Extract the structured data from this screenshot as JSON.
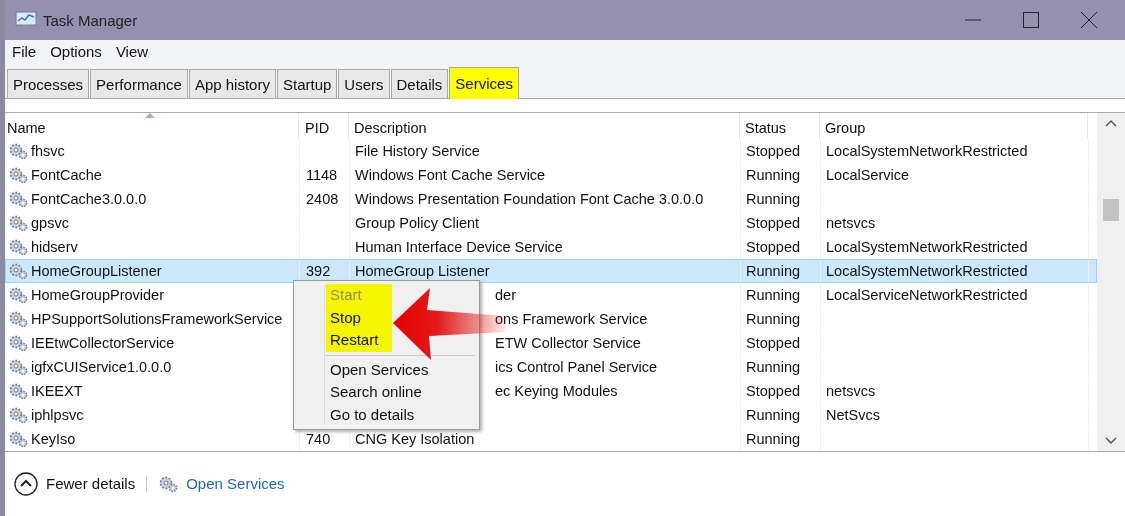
{
  "window": {
    "title": "Task Manager"
  },
  "menu": [
    "File",
    "Options",
    "View"
  ],
  "tabs": [
    {
      "label": "Processes",
      "selected": false,
      "highlighted": false
    },
    {
      "label": "Performance",
      "selected": false,
      "highlighted": false
    },
    {
      "label": "App history",
      "selected": false,
      "highlighted": false
    },
    {
      "label": "Startup",
      "selected": false,
      "highlighted": false
    },
    {
      "label": "Users",
      "selected": false,
      "highlighted": false
    },
    {
      "label": "Details",
      "selected": false,
      "highlighted": false
    },
    {
      "label": "Services",
      "selected": true,
      "highlighted": true
    }
  ],
  "table": {
    "columns": [
      {
        "label": "Name",
        "sorted": true
      },
      {
        "label": "PID",
        "sorted": false
      },
      {
        "label": "Description",
        "sorted": false
      },
      {
        "label": "Status",
        "sorted": false
      },
      {
        "label": "Group",
        "sorted": false
      }
    ],
    "rows": [
      {
        "name": "fhsvc",
        "description": "File History Service",
        "status": "Stopped",
        "group": "LocalSystemNetworkRestricted",
        "selected": false,
        "covered": false
      },
      {
        "name": "FontCache",
        "pid": "1148",
        "description": "Windows Font Cache Service",
        "status": "Running",
        "group": "LocalService",
        "selected": false,
        "covered": false
      },
      {
        "name": "FontCache3.0.0.0",
        "pid": "2408",
        "description": "Windows Presentation Foundation Font Cache 3.0.0.0",
        "status": "Running",
        "selected": false,
        "covered": false
      },
      {
        "name": "gpsvc",
        "description": "Group Policy Client",
        "status": "Stopped",
        "group": "netsvcs",
        "selected": false,
        "covered": false
      },
      {
        "name": "hidserv",
        "description": "Human Interface Device Service",
        "status": "Stopped",
        "group": "LocalSystemNetworkRestricted",
        "selected": false,
        "covered": false
      },
      {
        "name": "HomeGroupListener",
        "pid": "392",
        "description": "HomeGroup Listener",
        "status": "Running",
        "group": "LocalSystemNetworkRestricted",
        "selected": true,
        "covered": false
      },
      {
        "name": "HomeGroupProvider",
        "description": "der",
        "status": "Running",
        "group": "LocalServiceNetworkRestricted",
        "selected": false,
        "covered": true
      },
      {
        "name": "HPSupportSolutionsFrameworkService",
        "description": "ons Framework Service",
        "status": "Running",
        "selected": false,
        "covered": true
      },
      {
        "name": "IEEtwCollectorService",
        "description": "ETW Collector Service",
        "status": "Stopped",
        "selected": false,
        "covered": true
      },
      {
        "name": "igfxCUIService1.0.0.0",
        "description": "ics Control Panel Service",
        "status": "Running",
        "selected": false,
        "covered": true
      },
      {
        "name": "IKEEXT",
        "description": "ec Keying Modules",
        "status": "Stopped",
        "group": "netsvcs",
        "selected": false,
        "covered": true
      },
      {
        "name": "iphlpsvc",
        "status": "Running",
        "group": "NetSvcs",
        "selected": false
      },
      {
        "name": "KeyIso",
        "pid": "740",
        "description": "CNG Key Isolation",
        "status": "Running",
        "selected": false,
        "covered": false
      }
    ]
  },
  "context_menu": {
    "items": [
      {
        "label": "Start",
        "disabled": true,
        "highlighted": true
      },
      {
        "label": "Stop",
        "disabled": false,
        "highlighted": true
      },
      {
        "label": "Restart",
        "disabled": false,
        "highlighted": true,
        "separator_after": true
      },
      {
        "label": "Open Services",
        "disabled": false,
        "highlighted": false
      },
      {
        "label": "Search online",
        "disabled": false,
        "highlighted": false
      },
      {
        "label": "Go to details",
        "disabled": false,
        "highlighted": false
      }
    ]
  },
  "footer": {
    "fewer_details": "Fewer details",
    "open_services": "Open Services"
  }
}
